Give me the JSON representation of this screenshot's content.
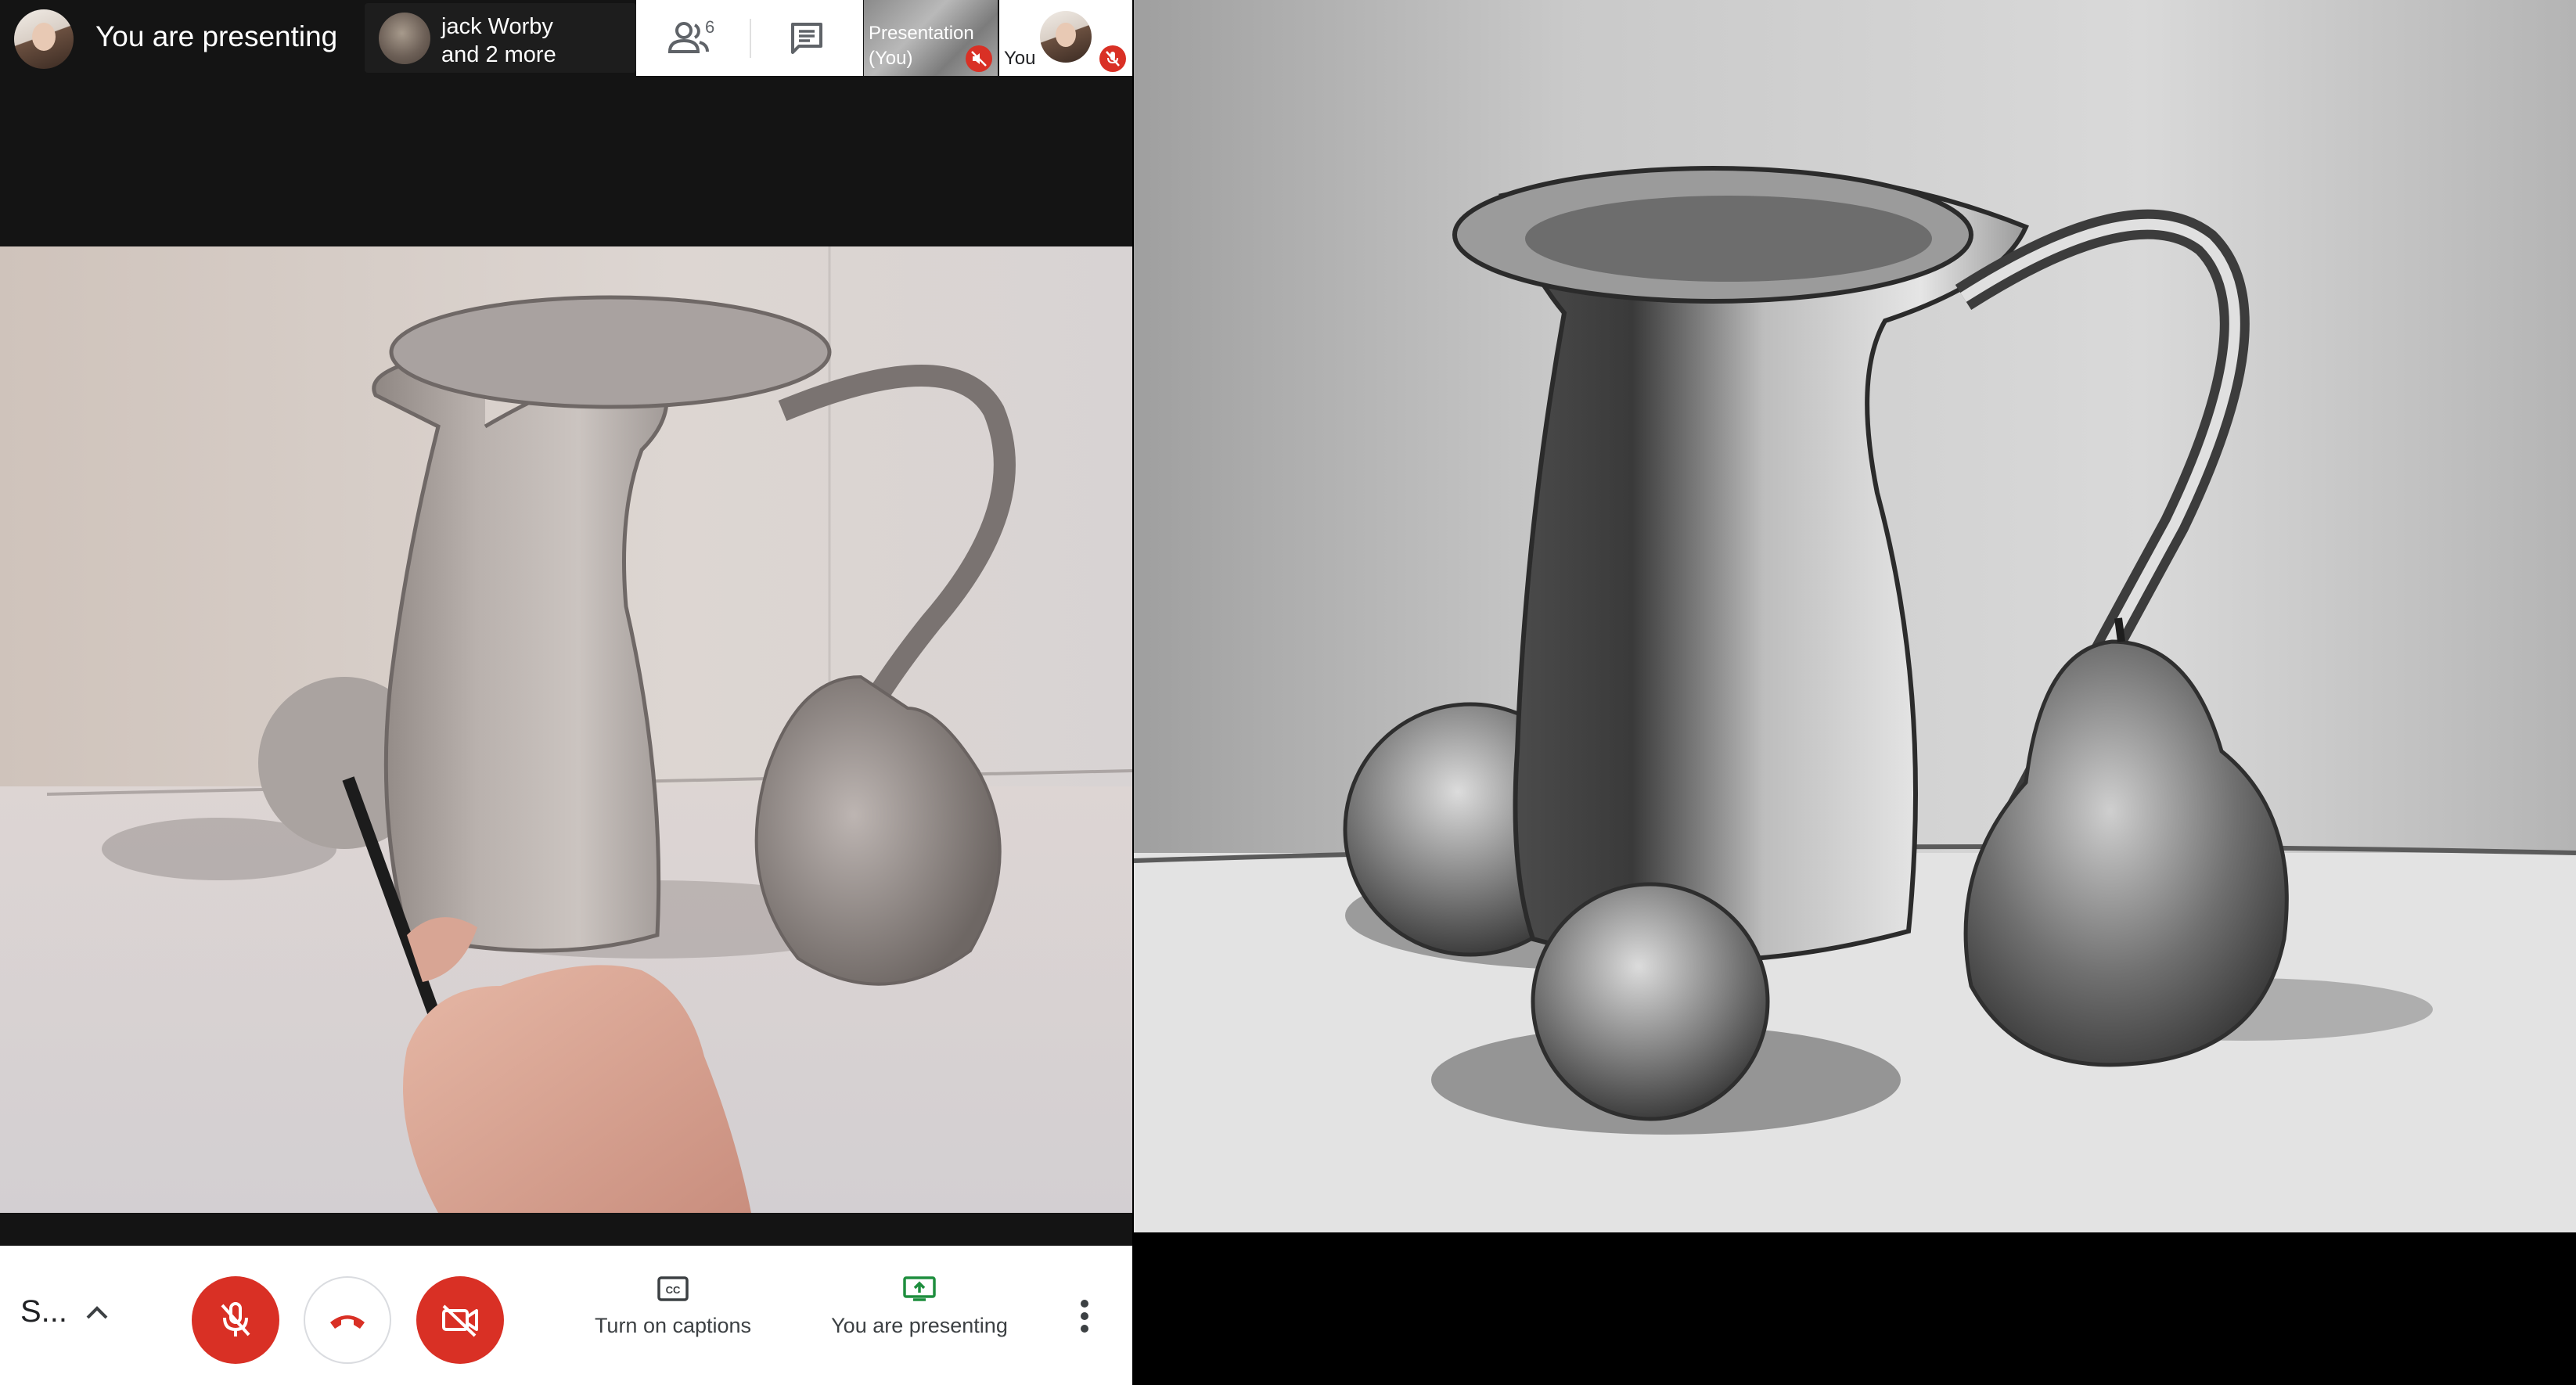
{
  "topbar": {
    "self_title": "You are presenting",
    "participants_line1": "jack Worby",
    "participants_line2": "and 2 more",
    "people_count": "6",
    "presentation_tile_line1": "Presentation",
    "presentation_tile_line2": "(You)",
    "you_tile_label": "You"
  },
  "controls": {
    "name_truncated": "S...",
    "captions_label": "Turn on captions",
    "presenting_label": "You are presenting"
  },
  "colors": {
    "danger": "#d93025",
    "present_green": "#1e8e3e",
    "meet_dark": "#141414"
  },
  "icons": [
    "people-icon",
    "chat-icon",
    "mic-off-icon",
    "end-call-icon",
    "camera-off-icon",
    "captions-icon",
    "present-icon",
    "more-vert-icon",
    "chevron-up-icon"
  ]
}
